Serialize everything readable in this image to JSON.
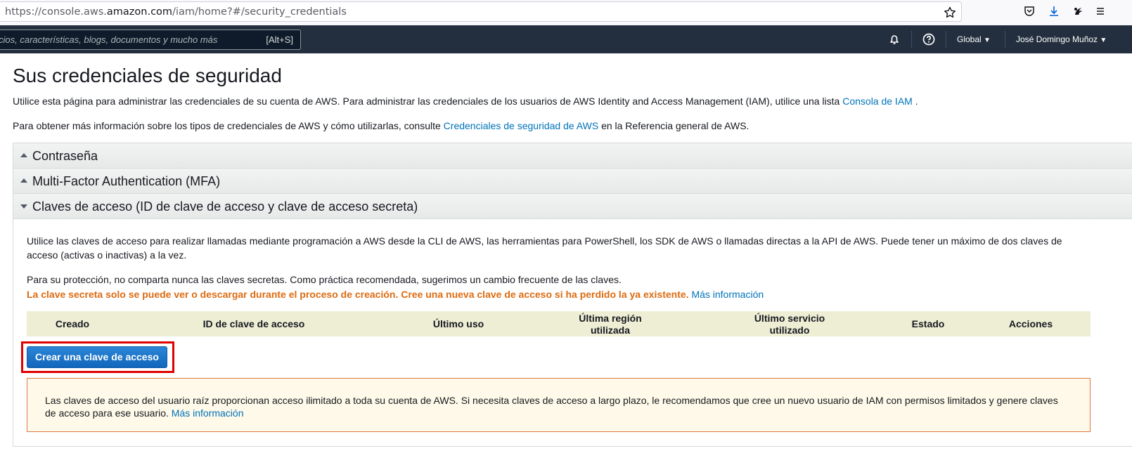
{
  "browser": {
    "url_prefix": "https://console.aws.",
    "url_host": "amazon.com",
    "url_path": "/iam/home?#/security_credentials"
  },
  "nav": {
    "search_placeholder": "cios, características, blogs, documentos y mucho más",
    "search_shortcut": "[Alt+S]",
    "region": "Global",
    "user": "José Domingo Muñoz"
  },
  "page": {
    "title": "Sus credenciales de seguridad",
    "intro1_text": "Utilice esta página para administrar las credenciales de su cuenta de AWS. Para administrar las credenciales de los usuarios de AWS Identity and Access Management (IAM), utilice una lista",
    "intro1_link": "Consola de IAM",
    "intro1_end": ".",
    "intro2_text": "Para obtener más información sobre los tipos de credenciales de AWS y cómo utilizarlas, consulte",
    "intro2_link": "Credenciales de seguridad de AWS",
    "intro2_end": "en la Referencia general de AWS."
  },
  "sections": {
    "password": "Contraseña",
    "mfa": "Multi-Factor Authentication (MFA)",
    "access_keys": "Claves de acceso (ID de clave de acceso y clave de acceso secreta)"
  },
  "access_keys": {
    "desc": "Utilice las claves de acceso para realizar llamadas mediante programación a AWS desde la CLI de AWS, las herramientas para PowerShell, los SDK de AWS o llamadas directas a la API de AWS. Puede tener un máximo de dos claves de acceso (activas o inactivas) a la vez.",
    "protection": "Para su protección, no comparta nunca las claves secretas. Como práctica recomendada, sugerimos un cambio frecuente de las claves.",
    "warning": "La clave secreta solo se puede ver o descargar durante el proceso de creación. Cree una nueva clave de acceso si ha perdido la ya existente.",
    "warning_link": "Más información",
    "columns": {
      "created": "Creado",
      "key_id": "ID de clave de acceso",
      "last_used": "Último uso",
      "last_region_1": "Última región",
      "last_region_2": "utilizada",
      "last_service_1": "Último servicio",
      "last_service_2": "utilizado",
      "status": "Estado",
      "actions": "Acciones"
    },
    "create_button": "Crear una clave de acceso",
    "alert_text": "Las claves de acceso del usuario raíz proporcionan acceso ilimitado a toda su cuenta de AWS. Si necesita claves de acceso a largo plazo, le recomendamos que cree un nuevo usuario de IAM con permisos limitados y genere claves de acceso para ese usuario.",
    "alert_link": "Más información"
  },
  "colors": {
    "nav_bg": "#232f3e",
    "link": "#0073bb",
    "warning_orange": "#dd6b10",
    "button_blue": "#1166bb",
    "highlight_red": "#e10000"
  }
}
